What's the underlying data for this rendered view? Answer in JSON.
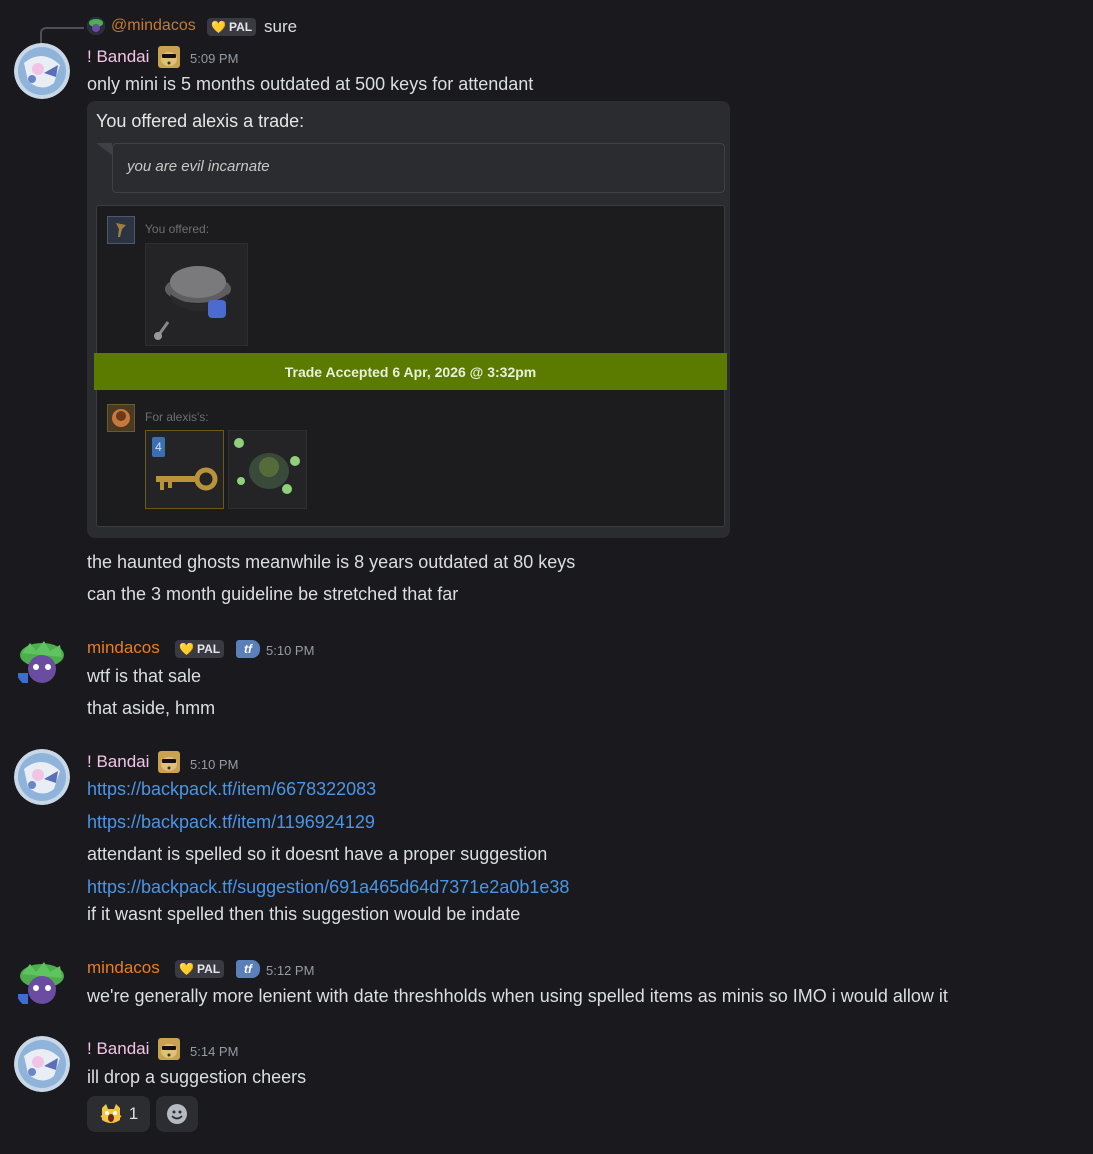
{
  "reply": {
    "username": "@mindacos",
    "badge": "PAL",
    "text": "sure"
  },
  "messages": [
    {
      "username": "! Bandai",
      "timestamp": "5:09 PM",
      "lines": [
        "only mini is 5 months outdated at 500 keys for attendant"
      ],
      "embed": {
        "title": "You offered alexis a trade:",
        "quote": "you are evil incarnate",
        "you_offered_label": "You offered:",
        "accepted_text": "Trade Accepted 6 Apr, 2026 @ 3:32pm",
        "for_label": "For alexis's:",
        "key_count": "4"
      },
      "after_lines": [
        "the haunted ghosts meanwhile is 8 years outdated at 80 keys",
        "can the 3 month guideline be stretched that far"
      ]
    },
    {
      "username": "mindacos",
      "badge": "PAL",
      "tf_badge": "tf",
      "timestamp": "5:10 PM",
      "lines": [
        "wtf is that sale",
        "that aside, hmm"
      ]
    },
    {
      "username": "! Bandai",
      "timestamp": "5:10 PM",
      "link1": "https://backpack.tf/item/6678322083",
      "link2": "https://backpack.tf/item/1196924129",
      "line1": "attendant is spelled so it doesnt have a proper suggestion",
      "link3": "https://backpack.tf/suggestion/691a465d64d7371e2a0b1e38",
      "line2": "if it wasnt spelled then this suggestion would be indate"
    },
    {
      "username": "mindacos",
      "badge": "PAL",
      "tf_badge": "tf",
      "timestamp": "5:12 PM",
      "lines": [
        "we're generally more lenient with date threshholds when using spelled items as minis so IMO i would allow it"
      ]
    },
    {
      "username": "! Bandai",
      "timestamp": "5:14 PM",
      "lines": [
        "ill drop a suggestion cheers"
      ],
      "reaction": {
        "emoji": "scream-cat",
        "count": "1"
      }
    }
  ],
  "colors": {
    "background": "#1a1a1e",
    "bandai_name": "#f1c4e6",
    "mindacos_name": "#e67e22",
    "link": "#4a95e6",
    "trade_accepted": "#5a7a00"
  }
}
